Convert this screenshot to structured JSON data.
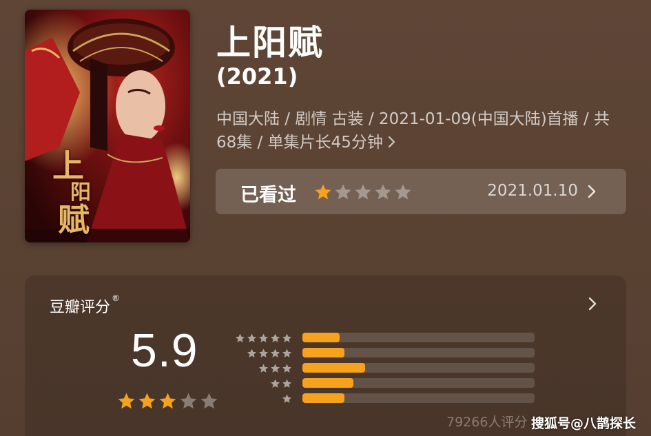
{
  "movie": {
    "title": "上阳赋",
    "year": "(2021)",
    "meta_line": "中国大陆 / 剧情 古装 / 2021-01-09(中国大陆)首播 / 共68集 / 单集片长45分钟",
    "poster_title_chars": [
      "上",
      "阳",
      "赋"
    ]
  },
  "watched": {
    "label": "已看过",
    "my_rating_stars": 1,
    "max_stars": 5,
    "date": "2021.01.10"
  },
  "rating": {
    "title": "豆瓣评分",
    "registered_mark": "®",
    "score": "5.9",
    "score_stars": 3,
    "max_stars": 5,
    "distribution": [
      {
        "stars": 5,
        "fraction": 0.16
      },
      {
        "stars": 4,
        "fraction": 0.18
      },
      {
        "stars": 3,
        "fraction": 0.27
      },
      {
        "stars": 2,
        "fraction": 0.22
      },
      {
        "stars": 1,
        "fraction": 0.18
      }
    ],
    "votes": "79266人评分"
  },
  "watermark": "搜狐号@八鹊探长",
  "colors": {
    "star_active": "#f6a21d",
    "star_inactive": "rgba(255,255,255,0.35)",
    "bar_fill": "#f6a21d",
    "background": "#5b4334"
  },
  "icons": {
    "meta_chevron": "chevron-right-icon",
    "watched_chevron": "chevron-right-icon",
    "rating_chevron": "chevron-right-icon",
    "star": "star-icon"
  }
}
